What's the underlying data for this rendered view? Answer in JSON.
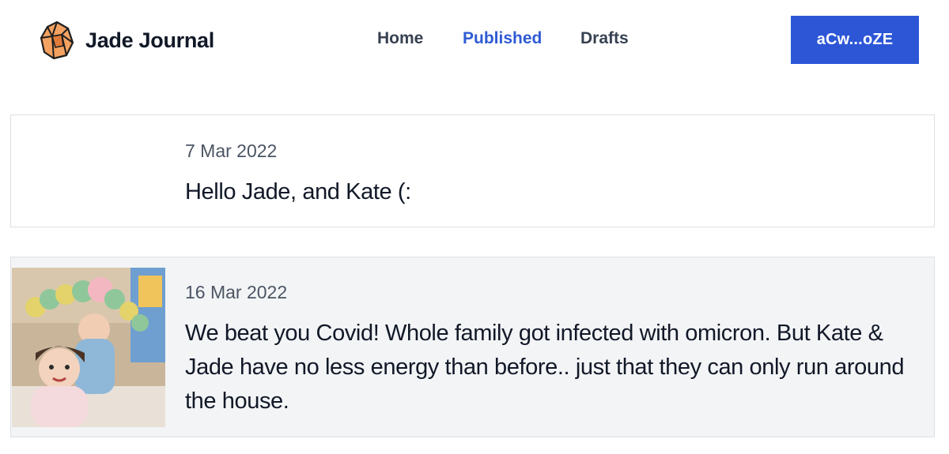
{
  "brand": {
    "name": "Jade Journal",
    "logo_icon": "gem-icon"
  },
  "nav": {
    "links": [
      {
        "label": "Home",
        "active": false
      },
      {
        "label": "Published",
        "active": true
      },
      {
        "label": "Drafts",
        "active": false
      }
    ]
  },
  "account": {
    "label": "aCw...oZE"
  },
  "colors": {
    "accent": "#2c56d6",
    "active_link": "#2f5bd3",
    "card_alt_bg": "#f3f4f6"
  },
  "posts": [
    {
      "date": "7 Mar 2022",
      "text": "Hello Jade, and Kate (:",
      "has_image": false
    },
    {
      "date": "16 Mar 2022",
      "text": "We beat you Covid! Whole family got infected with omicron. But Kate & Jade have no less energy than before.. just that they can only run around the house.",
      "has_image": true,
      "image": "photo of two children playing with plush caterpillar toy"
    }
  ]
}
